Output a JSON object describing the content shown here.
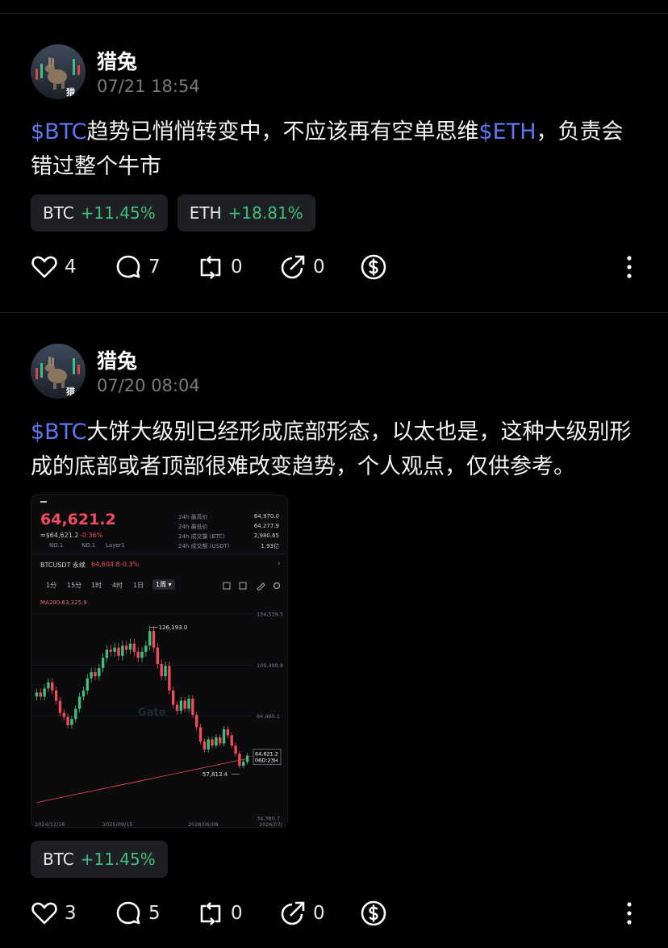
{
  "posts": [
    {
      "author": "猎兔",
      "avatar_caption": "猎",
      "timestamp": "07/21 18:54",
      "content": [
        {
          "text": "$BTC",
          "cashtag": true
        },
        {
          "text": "趋势已悄悄转变中，不应该再有空单思维",
          "cashtag": false
        },
        {
          "text": "$ETH",
          "cashtag": true
        },
        {
          "text": "，负责会错过整个牛市",
          "cashtag": false
        }
      ],
      "tags": [
        {
          "symbol": "BTC",
          "change": "+11.45%"
        },
        {
          "symbol": "ETH",
          "change": "+18.81%"
        }
      ],
      "actions": {
        "likes": "4",
        "comments": "7",
        "reposts": "0",
        "quotes": "0"
      }
    },
    {
      "author": "猎兔",
      "avatar_caption": "猎",
      "timestamp": "07/20 08:04",
      "content": [
        {
          "text": "$BTC",
          "cashtag": true
        },
        {
          "text": "大饼大级别已经形成底部形态，以太也是，这种大级别形成的底部或者顶部很难改变趋势，个人观点，仅供参考。",
          "cashtag": false
        }
      ],
      "tags": [
        {
          "symbol": "BTC",
          "change": "+11.45%"
        }
      ],
      "actions": {
        "likes": "3",
        "comments": "5",
        "reposts": "0",
        "quotes": "0"
      },
      "attachment": {
        "price": "64,621.2",
        "price_sub": "≈$64,621.2",
        "price_change": "-0.36%",
        "badges": [
          "NO.1",
          "NO.1",
          "Layer1"
        ],
        "stats": [
          {
            "label": "24h 最高价",
            "value": "64,970.0"
          },
          {
            "label": "24h 最低价",
            "value": "64,277.9"
          },
          {
            "label": "24h 成交量 (BTC)",
            "value": "2,980.65"
          },
          {
            "label": "24h 成交额 (USDT)",
            "value": "1.93亿"
          }
        ],
        "pair": "BTCUSDT 永续",
        "pair_price": "64,604.8",
        "pair_change": "-0.3%",
        "intervals": [
          "1分",
          "15分",
          "1时",
          "4时",
          "1日",
          "1周"
        ],
        "active_interval": "1周",
        "ma_label": "MA200:63,325.9",
        "watermark": "Gate",
        "countdown": "06D:23H",
        "chart_data": {
          "type": "candlestick",
          "y_ticks": [
            "134,539.5",
            "109,499.8",
            "84,460.1",
            "34,380.7"
          ],
          "ylim": [
            34380.7,
            134539.5
          ],
          "x_ticks": [
            "2024/12/16",
            "2025/09/15",
            "2026/06/08",
            "2026/07/"
          ],
          "annotations": [
            {
              "label": "126,193.0",
              "kind": "high"
            },
            {
              "label": "57,813.4",
              "kind": "low"
            }
          ],
          "last_price": "64,621.2",
          "closes": [
            96000,
            94000,
            98000,
            101000,
            97000,
            92000,
            86000,
            84000,
            80000,
            83000,
            88000,
            94000,
            97000,
            103000,
            106000,
            104000,
            108000,
            113000,
            117000,
            116000,
            118000,
            114000,
            119000,
            117000,
            120000,
            116000,
            113000,
            116000,
            119000,
            126193,
            118000,
            110000,
            104000,
            109000,
            97000,
            90000,
            87000,
            92000,
            88000,
            93000,
            85000,
            79000,
            72000,
            68000,
            73000,
            70000,
            74000,
            71000,
            78000,
            75000,
            70000,
            66000,
            60000,
            62000,
            65000
          ]
        }
      }
    }
  ]
}
